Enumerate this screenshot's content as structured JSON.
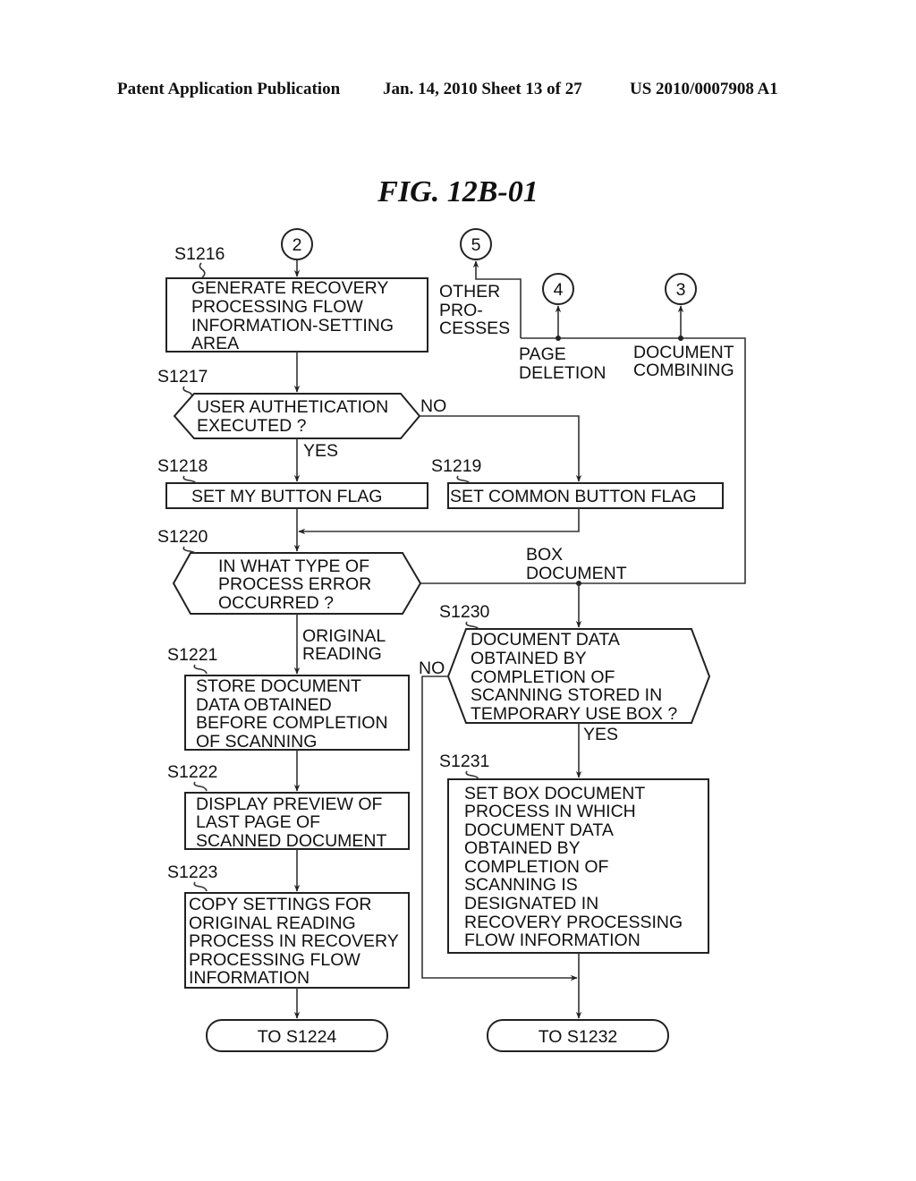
{
  "header": {
    "publication": "Patent Application Publication",
    "date_sheet": "Jan. 14, 2010  Sheet 13 of 27",
    "number": "US 2010/0007908 A1"
  },
  "figure_title": "FIG. 12B-01",
  "connectors": {
    "c2": "2",
    "c5": "5",
    "c4": "4",
    "c3": "3"
  },
  "steps": {
    "s1216": {
      "id": "S1216",
      "lines": [
        "GENERATE RECOVERY",
        "PROCESSING FLOW",
        "INFORMATION-SETTING",
        "AREA"
      ]
    },
    "s1217": {
      "id": "S1217",
      "lines": [
        "USER AUTHETICATION",
        "EXECUTED ?"
      ]
    },
    "s1218": {
      "id": "S1218",
      "lines": [
        "SET MY BUTTON FLAG"
      ]
    },
    "s1219": {
      "id": "S1219",
      "lines": [
        "SET COMMON BUTTON FLAG"
      ]
    },
    "s1220": {
      "id": "S1220",
      "lines": [
        "IN WHAT TYPE OF",
        "PROCESS ERROR",
        "OCCURRED ?"
      ]
    },
    "s1221": {
      "id": "S1221",
      "lines": [
        "STORE DOCUMENT",
        "DATA OBTAINED",
        "BEFORE COMPLETION",
        "OF SCANNING"
      ]
    },
    "s1222": {
      "id": "S1222",
      "lines": [
        "DISPLAY PREVIEW OF",
        "LAST PAGE OF",
        "SCANNED DOCUMENT"
      ]
    },
    "s1223": {
      "id": "S1223",
      "lines": [
        "COPY SETTINGS FOR",
        "ORIGINAL READING",
        "PROCESS IN RECOVERY",
        "PROCESSING FLOW",
        "INFORMATION"
      ]
    },
    "s1230": {
      "id": "S1230",
      "lines": [
        "DOCUMENT DATA",
        "OBTAINED BY",
        "COMPLETION OF",
        "SCANNING STORED IN",
        "TEMPORARY USE BOX ?"
      ]
    },
    "s1231": {
      "id": "S1231",
      "lines": [
        "SET BOX DOCUMENT",
        "PROCESS IN WHICH",
        "DOCUMENT DATA",
        "OBTAINED BY",
        "COMPLETION OF",
        "SCANNING IS",
        "DESIGNATED IN",
        "RECOVERY PROCESSING",
        "FLOW INFORMATION"
      ]
    }
  },
  "terminals": {
    "t1224": "TO S1224",
    "t1232": "TO S1232"
  },
  "branch_labels": {
    "no_1217": "NO",
    "yes_1217": "YES",
    "other_processes": [
      "OTHER",
      "PRO-",
      "CESSES"
    ],
    "page_deletion": [
      "PAGE",
      "DELETION"
    ],
    "document_combining": [
      "DOCUMENT",
      "COMBINING"
    ],
    "box_document": [
      "BOX",
      "DOCUMENT"
    ],
    "original_reading": [
      "ORIGINAL",
      "READING"
    ],
    "no_1230": "NO",
    "yes_1230": "YES"
  }
}
